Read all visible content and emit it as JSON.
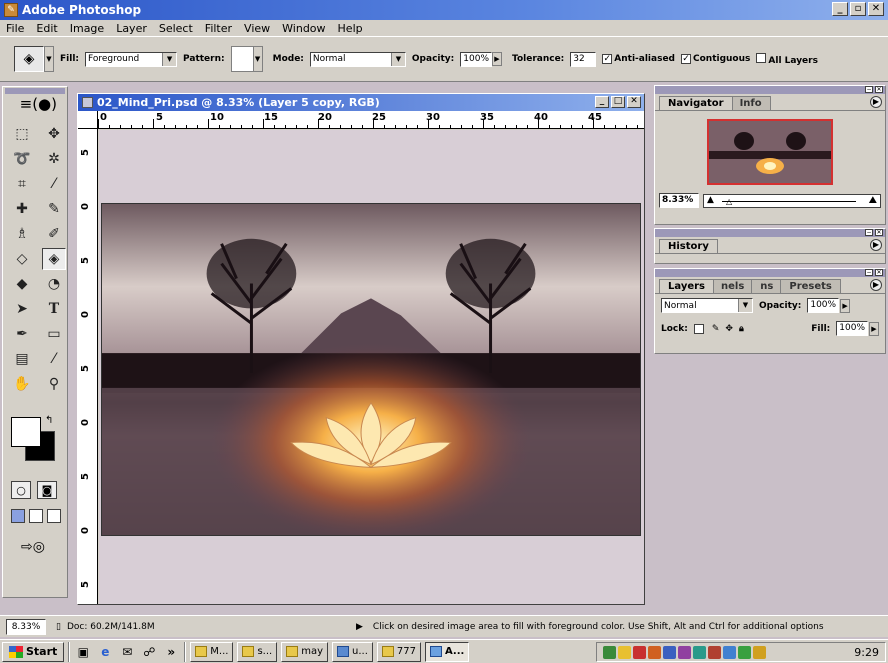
{
  "app": {
    "title": "Adobe Photoshop"
  },
  "menu": [
    "File",
    "Edit",
    "Image",
    "Layer",
    "Select",
    "Filter",
    "View",
    "Window",
    "Help"
  ],
  "options_bar": {
    "fill_label": "Fill:",
    "fill_value": "Foreground",
    "pattern_label": "Pattern:",
    "mode_label": "Mode:",
    "mode_value": "Normal",
    "opacity_label": "Opacity:",
    "opacity_value": "100%",
    "tolerance_label": "Tolerance:",
    "tolerance_value": "32",
    "anti_aliased": "Anti-aliased",
    "contiguous": "Contiguous",
    "all_layers": "All Layers"
  },
  "document": {
    "title": "02_Mind_Pri.psd @ 8.33% (Layer 5 copy, RGB)",
    "h_ruler": [
      "0",
      "5",
      "10",
      "15",
      "20",
      "25",
      "30",
      "35",
      "40",
      "45"
    ],
    "v_ruler": [
      "5",
      "0",
      "5",
      "0",
      "5",
      "0",
      "5",
      "0",
      "5"
    ]
  },
  "navigator": {
    "tabs": [
      "Navigator",
      "Info"
    ],
    "zoom": "8.33%"
  },
  "history": {
    "tab": "History"
  },
  "layers": {
    "tabs": [
      "Layers",
      "nels",
      "ns",
      "Presets"
    ],
    "blend_mode": "Normal",
    "opacity_label": "Opacity:",
    "opacity_value": "100%",
    "lock_label": "Lock:",
    "fill_label": "Fill:",
    "fill_value": "100%"
  },
  "status": {
    "zoom": "8.33%",
    "doc": "Doc: 60.2M/141.8M",
    "hint": "Click on desired image area to fill with foreground color. Use Shift, Alt and Ctrl for additional options"
  },
  "taskbar": {
    "start": "Start",
    "buttons": [
      "M...",
      "s...",
      "may",
      "u...",
      "777",
      "A..."
    ],
    "clock": "9:29"
  },
  "colors": {
    "title_bar": "#2b56c8",
    "chrome": "#d4d0c8",
    "workspace": "#c9bfc8"
  }
}
